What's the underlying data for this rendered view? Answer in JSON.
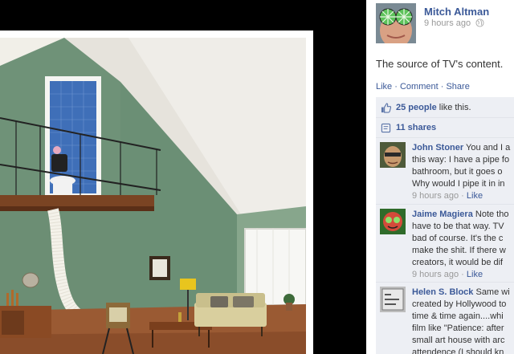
{
  "post": {
    "author": "Mitch Altman",
    "time": "9 hours ago",
    "caption": "The source of TV's content.",
    "actions": {
      "like": "Like",
      "comment": "Comment",
      "share": "Share",
      "separator": "·"
    }
  },
  "ufi": {
    "likes_link": "25 people",
    "likes_suffix": " like this.",
    "shares": "11 shares"
  },
  "comments": [
    {
      "author": "John Stoner",
      "lines_first": " You and I a",
      "lines": [
        "this way: I have a pipe fo",
        "bathroom, but it goes o",
        "Why would I pipe it in in"
      ],
      "time": "9 hours ago",
      "like": "Like"
    },
    {
      "author": "Jaime Magiera",
      "lines_first": " Note tho",
      "lines": [
        "have to be that way. TV",
        "bad of course. It's the c",
        "make the shit. If there w",
        "creators, it would be dif"
      ],
      "time": "9 hours ago",
      "like": "Like"
    },
    {
      "author": "Helen S. Block",
      "lines_first": " Same wi",
      "lines": [
        "created by Hollywood to",
        "time & time again....whi",
        "film like \"Patience: after",
        "small art house with arc",
        "attendence (I should kn"
      ],
      "time": "",
      "like": ""
    }
  ],
  "colors": {
    "link": "#3b5998",
    "ufi_bg": "#edeff4",
    "muted": "#999999",
    "wall_green": "#6f9278",
    "floor_wood": "#9a5a33"
  },
  "icons": {
    "globe": "globe-icon",
    "thumbs_up": "thumbs-up-icon",
    "share": "share-icon"
  }
}
